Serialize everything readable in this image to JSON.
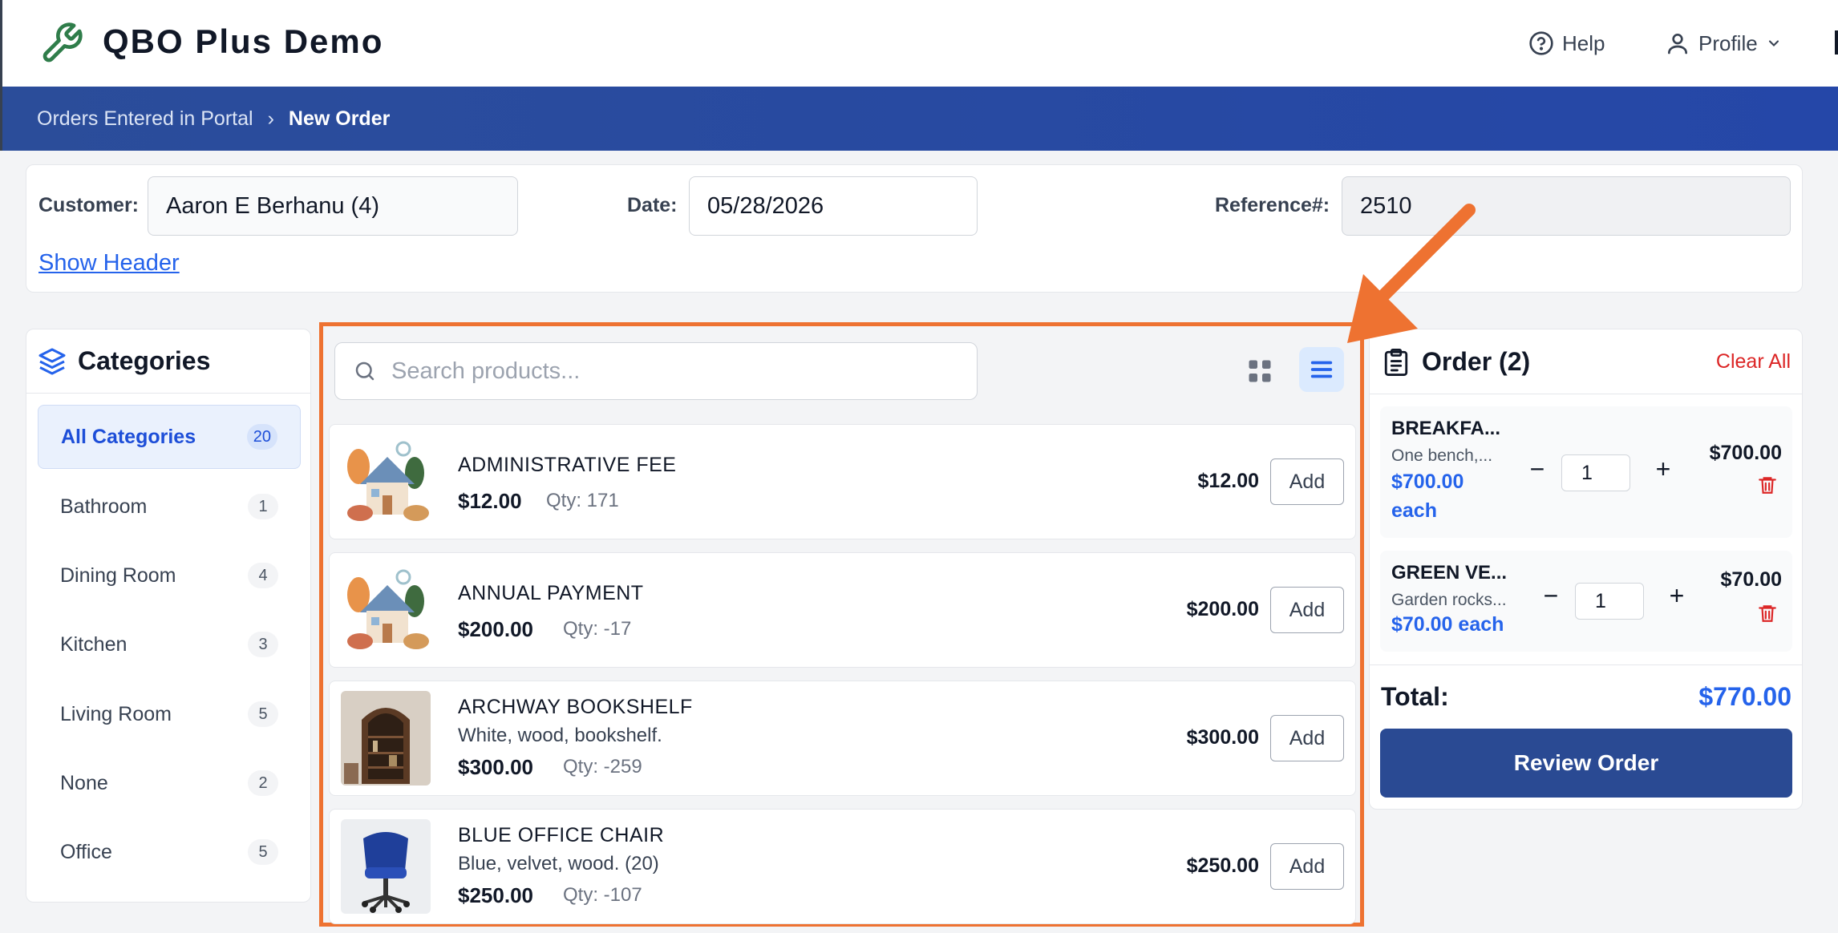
{
  "app": {
    "title": "QBO Plus Demo"
  },
  "topnav": {
    "help_label": "Help",
    "profile_label": "Profile"
  },
  "breadcrumb": {
    "parent": "Orders Entered in Portal",
    "separator": "›",
    "current": "New Order"
  },
  "header": {
    "customer_label": "Customer:",
    "customer_value": "Aaron E Berhanu (4)",
    "date_label": "Date:",
    "date_value": "05/28/2026",
    "reference_label": "Reference#:",
    "reference_value": "2510",
    "show_header_link": "Show Header"
  },
  "categories": {
    "title": "Categories",
    "items": [
      {
        "label": "All Categories",
        "count": "20",
        "active": true
      },
      {
        "label": "Bathroom",
        "count": "1"
      },
      {
        "label": "Dining Room",
        "count": "4"
      },
      {
        "label": "Kitchen",
        "count": "3"
      },
      {
        "label": "Living Room",
        "count": "5"
      },
      {
        "label": "None",
        "count": "2"
      },
      {
        "label": "Office",
        "count": "5"
      }
    ]
  },
  "products": {
    "search_placeholder": "Search products...",
    "view_mode": "list",
    "add_label": "Add",
    "items": [
      {
        "name": "ADMINISTRATIVE FEE",
        "description": "",
        "price": "$12.00",
        "qty": "Qty: 171",
        "price_right": "$12.00",
        "image": "house-illustration"
      },
      {
        "name": "ANNUAL PAYMENT",
        "description": "",
        "price": "$200.00",
        "qty": "Qty: -17",
        "price_right": "$200.00",
        "image": "house-illustration"
      },
      {
        "name": "ARCHWAY BOOKSHELF",
        "description": "White, wood, bookshelf.",
        "price": "$300.00",
        "qty": "Qty: -259",
        "price_right": "$300.00",
        "image": "bookshelf-photo"
      },
      {
        "name": "BLUE OFFICE CHAIR",
        "description": "Blue, velvet, wood. (20)",
        "price": "$250.00",
        "qty": "Qty: -107",
        "price_right": "$250.00",
        "image": "office-chair-photo"
      }
    ]
  },
  "order": {
    "title": "Order (2)",
    "clear_all": "Clear All",
    "items": [
      {
        "name": "BREAKFA...",
        "description": "One bench,...",
        "each_line1": "$700.00",
        "each_line2": "each",
        "qty": "1",
        "total": "$700.00"
      },
      {
        "name": "GREEN VE...",
        "description": "Garden rocks...",
        "each": "$70.00 each",
        "qty": "1",
        "total": "$70.00"
      }
    ],
    "total_label": "Total:",
    "total_value": "$770.00",
    "review_button": "Review Order"
  },
  "colors": {
    "brand_blue": "#2a4a93",
    "accent_blue": "#2563eb",
    "highlight_orange": "#ee7231",
    "danger_red": "#dc2626"
  }
}
